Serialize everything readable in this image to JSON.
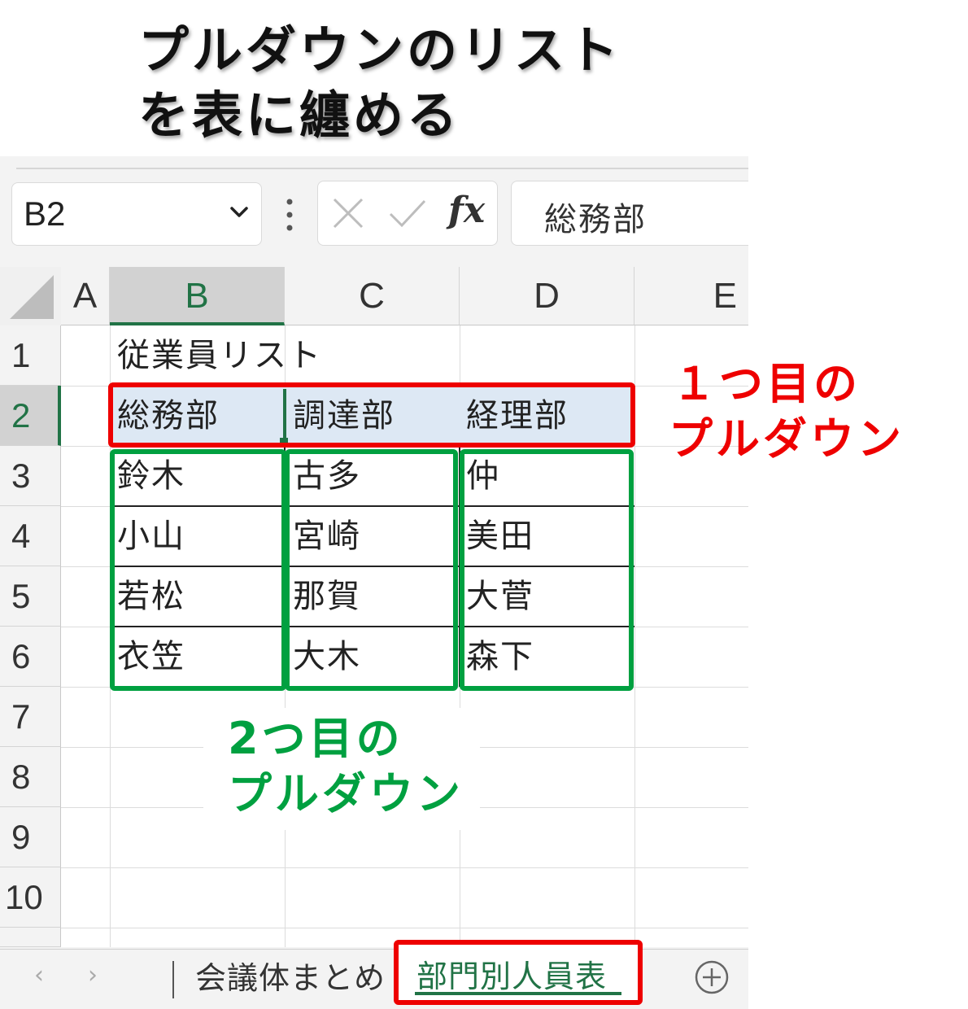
{
  "title": {
    "line1": "プルダウンのリスト",
    "line2": "を表に纏める"
  },
  "formula_bar": {
    "name_box": "B2",
    "content": "総務部",
    "cancel_icon": "close-icon",
    "enter_icon": "checkmark-icon",
    "function_label": "fx"
  },
  "columns": [
    "A",
    "B",
    "C",
    "D",
    "E"
  ],
  "rows": [
    "1",
    "2",
    "3",
    "4",
    "5",
    "6",
    "7",
    "8",
    "9",
    "10"
  ],
  "cells": {
    "B1": "従業員リスト",
    "B2": "総務部",
    "C2": "調達部",
    "D2": "経理部",
    "B3": "鈴木",
    "C3": "古多",
    "D3": "仲",
    "B4": "小山",
    "C4": "宮崎",
    "D4": "美田",
    "B5": "若松",
    "C5": "那賀",
    "D5": "大菅",
    "B6": "衣笠",
    "C6": "大木",
    "D6": "森下"
  },
  "annotations": {
    "first": {
      "line1": "１つ目の",
      "line2": "プルダウン",
      "color": "#ee0000"
    },
    "second": {
      "line1": "2つ目の",
      "line2": "プルダウン",
      "color": "#00a040"
    }
  },
  "sheet_tabs": {
    "tabs": [
      "会議体まとめ",
      "部門別人員表"
    ],
    "active": "部門別人員表",
    "add_icon": "plus-circle-icon"
  },
  "colors": {
    "accent_green": "#217346",
    "header_fill": "#dde8f4"
  }
}
